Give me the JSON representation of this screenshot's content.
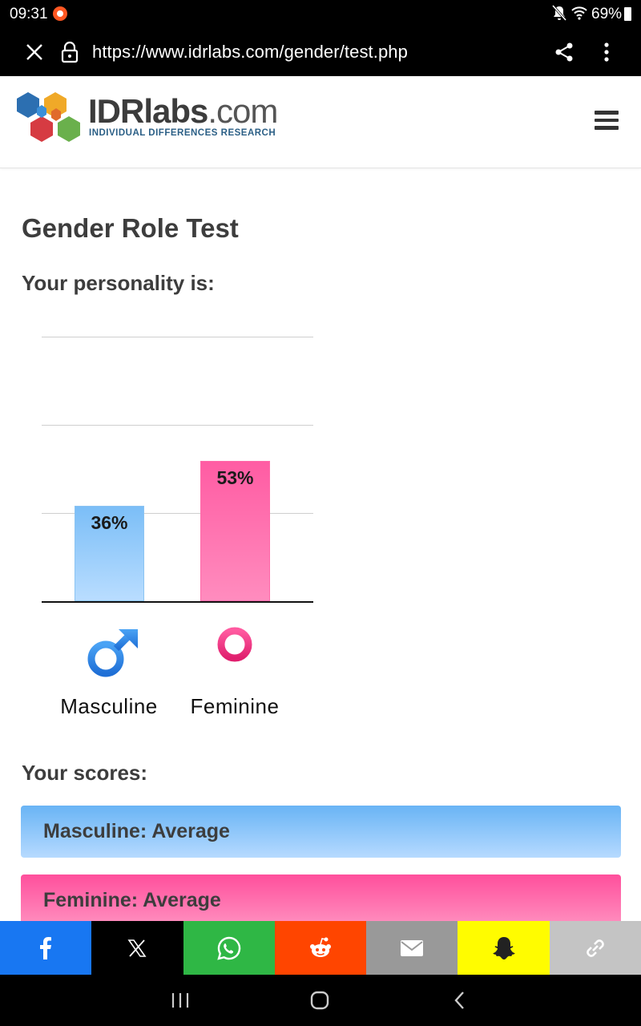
{
  "status_bar": {
    "time": "09:31",
    "battery": "69%"
  },
  "browser": {
    "url": "https://www.idrlabs.com/gender/test.php"
  },
  "site": {
    "logo_bold": "IDRlabs",
    "logo_light": ".com",
    "tagline": "INDIVIDUAL DIFFERENCES RESEARCH"
  },
  "page": {
    "title": "Gender Role Test",
    "personality_heading": "Your personality is:",
    "scores_heading": "Your scores:"
  },
  "chart_data": {
    "type": "bar",
    "categories": [
      "Masculine",
      "Feminine"
    ],
    "values": [
      36,
      53
    ],
    "value_labels": [
      "36%",
      "53%"
    ],
    "ylim": [
      0,
      100
    ],
    "grid": true,
    "colors": {
      "Masculine": "#8cc4f2",
      "Feminine": "#ff5ca3"
    }
  },
  "scores": [
    {
      "label": "Masculine: Average",
      "color": "#8cc4f2"
    },
    {
      "label": "Feminine: Average",
      "color": "#ff5ca3"
    }
  ],
  "share_buttons": [
    {
      "name": "facebook",
      "color": "#1877f2"
    },
    {
      "name": "x",
      "color": "#000000"
    },
    {
      "name": "whatsapp",
      "color": "#2fb745"
    },
    {
      "name": "reddit",
      "color": "#ff4500"
    },
    {
      "name": "email",
      "color": "#999999"
    },
    {
      "name": "snapchat",
      "color": "#fffc00"
    },
    {
      "name": "copy-link",
      "color": "#c4c4c4"
    }
  ]
}
